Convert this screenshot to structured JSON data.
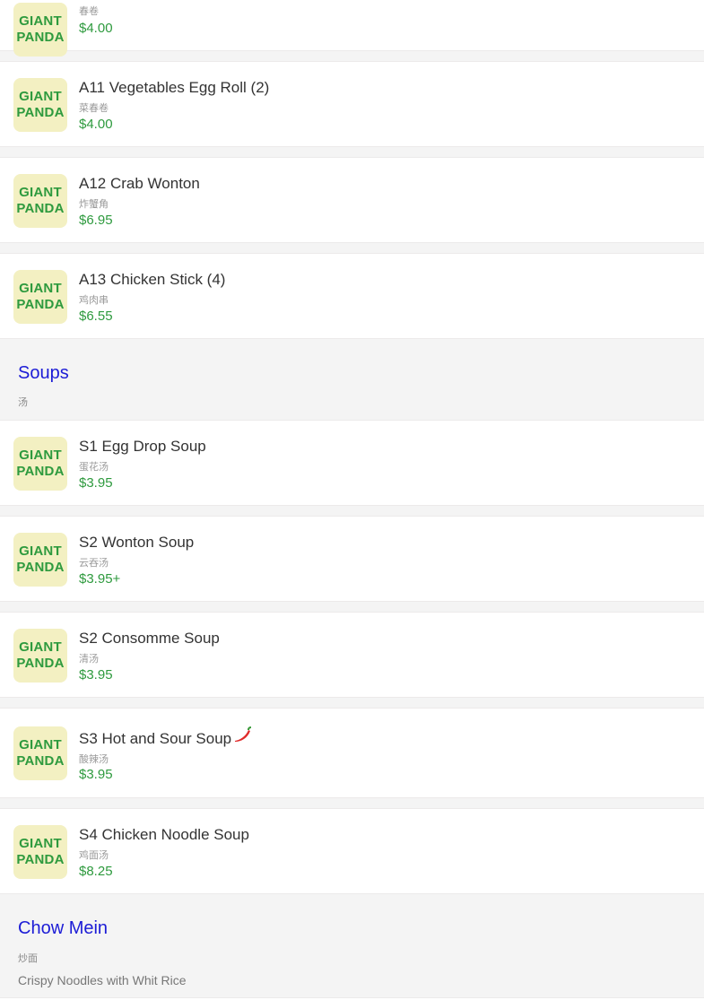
{
  "thumb": {
    "line1": "GIANT",
    "line2": "PANDA"
  },
  "items_top": [
    {
      "name": "",
      "cn": "春卷",
      "price": "$4.00"
    },
    {
      "name": "A11 Vegetables Egg Roll (2)",
      "cn": "菜春卷",
      "price": "$4.00"
    },
    {
      "name": "A12 Crab Wonton",
      "cn": "炸蟹角",
      "price": "$6.95"
    },
    {
      "name": "A13 Chicken Stick (4)",
      "cn": "鸡肉串",
      "price": "$6.55"
    }
  ],
  "soups": {
    "title": "Soups",
    "cn": "汤",
    "items": [
      {
        "name": "S1 Egg Drop Soup",
        "cn": "蛋花汤",
        "price": "$3.95"
      },
      {
        "name": "S2 Wonton Soup",
        "cn": "云吞汤",
        "price": "$3.95+"
      },
      {
        "name": "S2 Consomme Soup",
        "cn": "清汤",
        "price": "$3.95"
      },
      {
        "name": "S3 Hot and Sour Soup",
        "cn": "酸辣汤",
        "price": "$3.95",
        "spicy": true
      },
      {
        "name": "S4 Chicken Noodle Soup",
        "cn": "鸡面汤",
        "price": "$8.25"
      }
    ]
  },
  "chow_mein": {
    "title": "Chow Mein",
    "cn": "炒面",
    "desc": "Crispy Noodles with Whit Rice"
  },
  "colors": {
    "category_title": "#1c1cd6",
    "price": "#2e9a3e",
    "thumb_bg": "#f3f0c2"
  },
  "icons": {
    "spicy": "chili-pepper-icon",
    "thumb": "giant-panda-logo"
  }
}
